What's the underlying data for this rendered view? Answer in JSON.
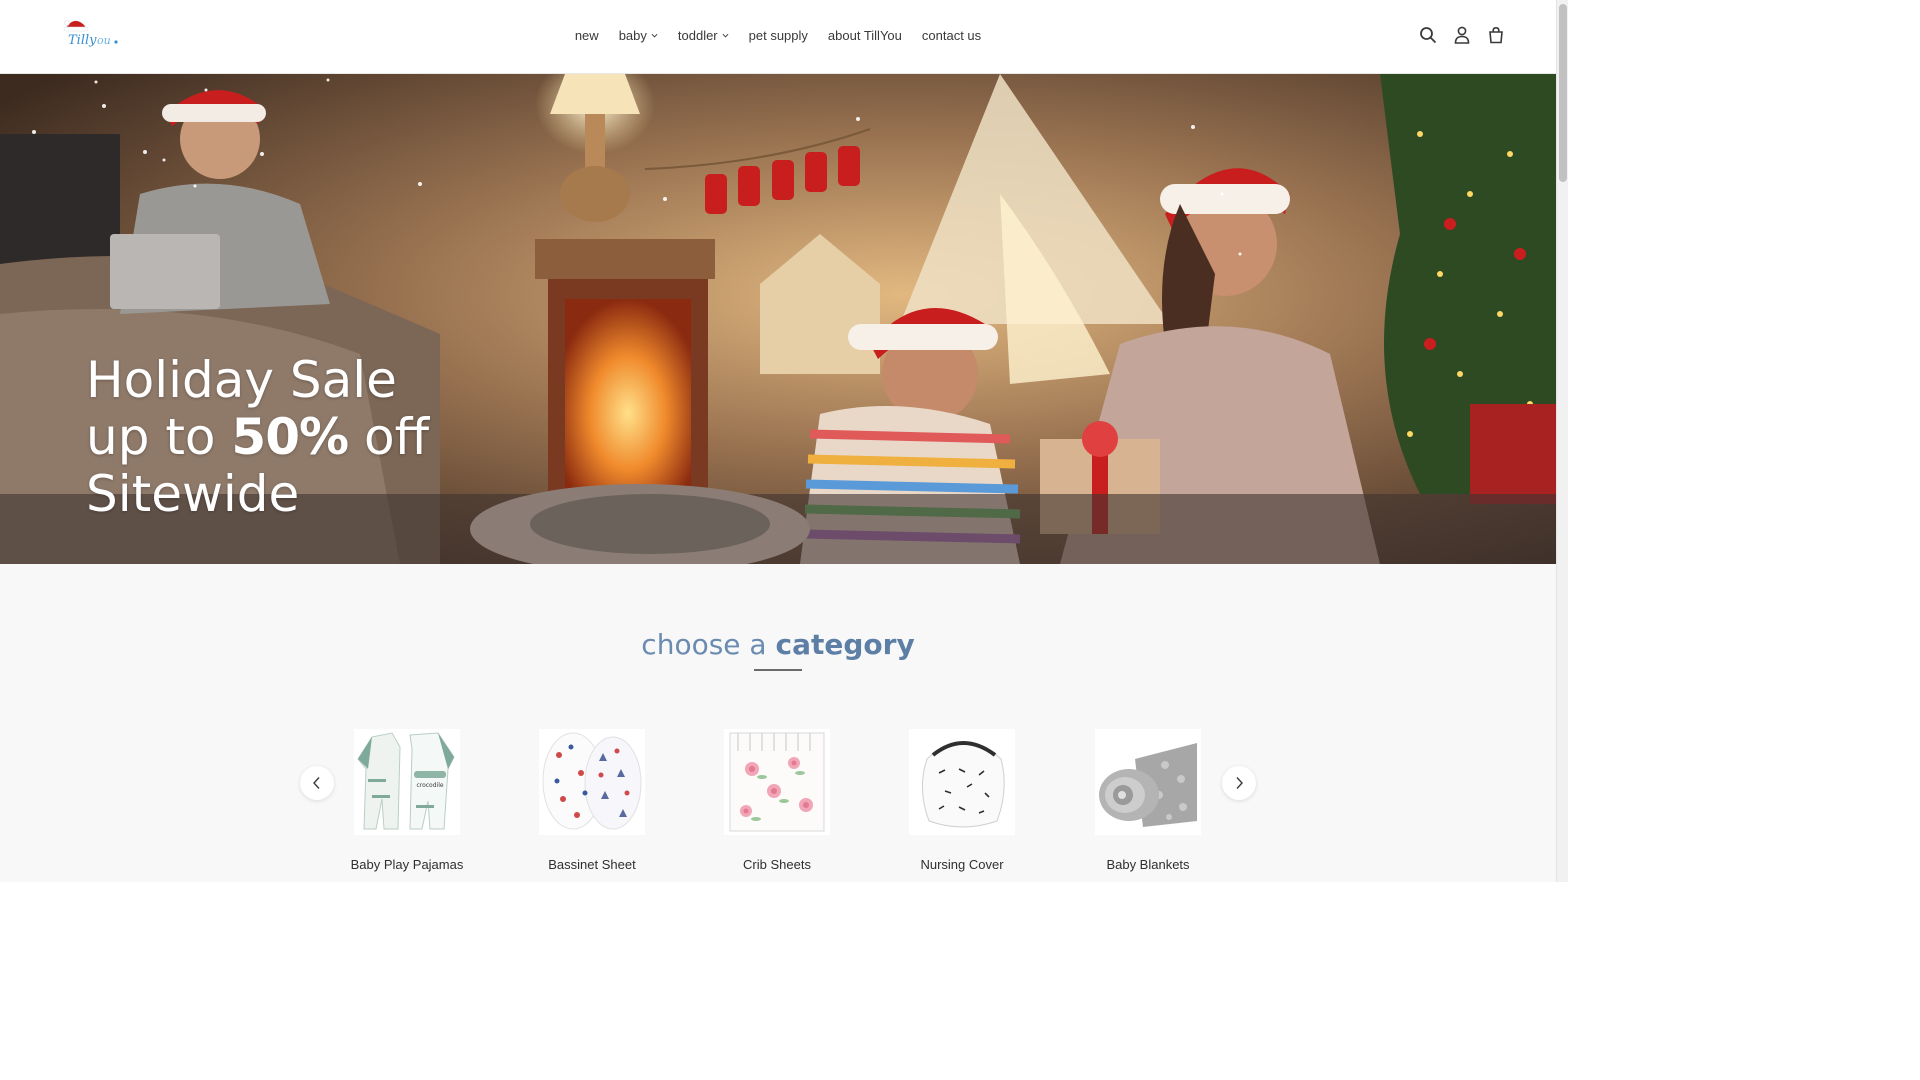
{
  "header": {
    "logo_text": "TillyOu",
    "nav": [
      {
        "label": "new",
        "dropdown": false
      },
      {
        "label": "baby",
        "dropdown": true
      },
      {
        "label": "toddler",
        "dropdown": true
      },
      {
        "label": "pet supply",
        "dropdown": false
      },
      {
        "label": "about TillYou",
        "dropdown": false
      },
      {
        "label": "contact us",
        "dropdown": false
      }
    ],
    "icons": [
      "search-icon",
      "account-icon",
      "cart-icon"
    ]
  },
  "hero": {
    "line1": "Holiday Sale",
    "line2_pre": "up to ",
    "line2_bold": "50%",
    "line2_post": " off",
    "line3": "Sitewide"
  },
  "category": {
    "title_light": "choose a ",
    "title_bold": "category",
    "items": [
      {
        "label": "Baby Play Pajamas"
      },
      {
        "label": "Bassinet Sheet"
      },
      {
        "label": "Crib Sheets"
      },
      {
        "label": "Nursing Cover"
      },
      {
        "label": "Baby Blankets"
      }
    ]
  },
  "colors": {
    "accent_blue": "#6b8cb0",
    "santa_red": "#c81e1e"
  }
}
